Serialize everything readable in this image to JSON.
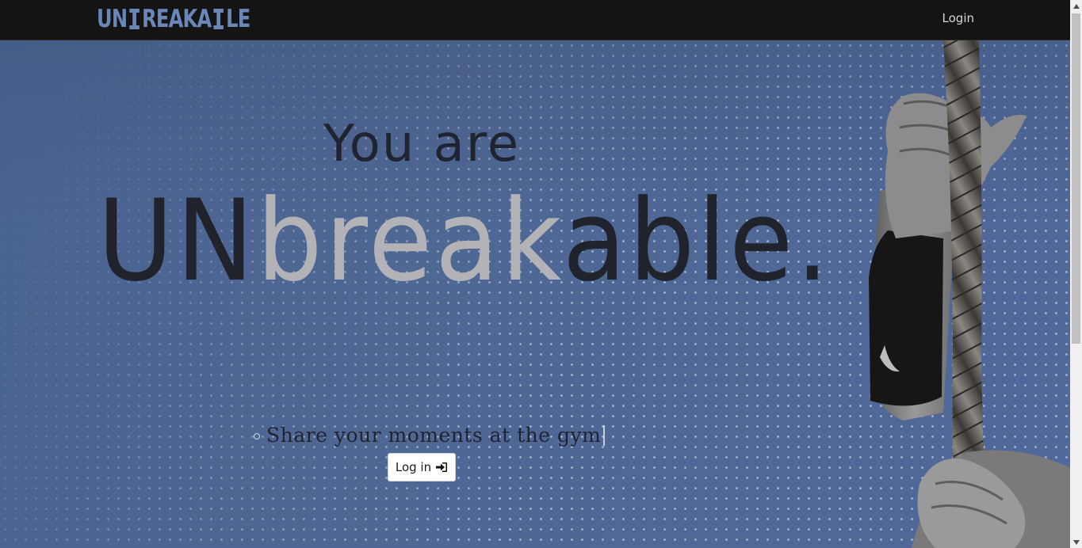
{
  "navbar": {
    "logo_text_left": "UN",
    "logo_text_mid": "REAKA",
    "logo_text_right": "LE",
    "login_label": "Login"
  },
  "hero": {
    "headline_small": "You are",
    "headline_big": {
      "part1": "UN",
      "part2": "break",
      "part3": "able."
    },
    "typed_text": "Share your moments at the gym",
    "login_button_label": "Log in"
  },
  "colors": {
    "navbar_bg": "#141414",
    "logo": "#6b86b8",
    "hero_bg": "#4d6590",
    "text_dark": "#20232c",
    "text_light": "#b3b3b7"
  },
  "icons": {
    "logo_symbol": "dumbbell-icon",
    "button_icon": "sign-in-icon"
  }
}
